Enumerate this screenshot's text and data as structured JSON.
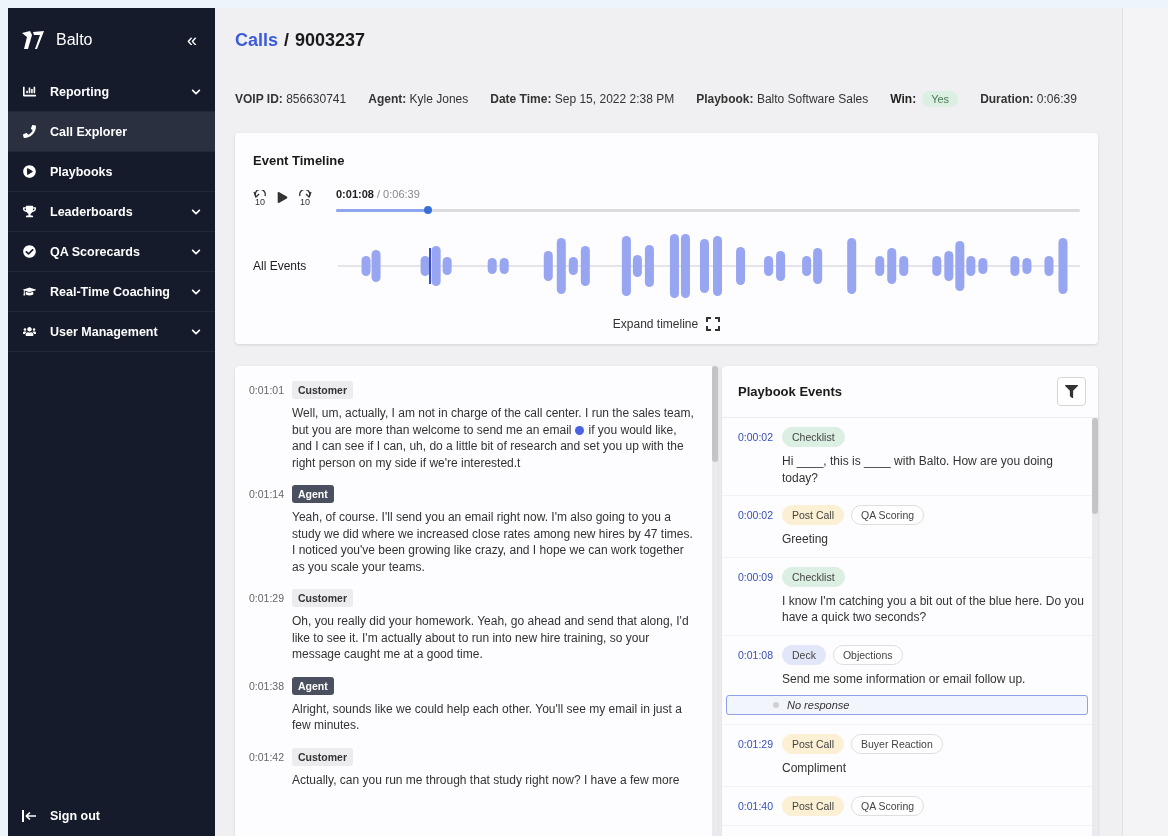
{
  "sidebar": {
    "brand": "Balto",
    "collapse": "«",
    "items": [
      {
        "label": "Reporting",
        "selected": false,
        "expandable": true
      },
      {
        "label": "Call Explorer",
        "selected": true,
        "expandable": false
      },
      {
        "label": "Playbooks",
        "selected": false,
        "expandable": false
      },
      {
        "label": "Leaderboards",
        "selected": false,
        "expandable": true
      },
      {
        "label": "QA Scorecards",
        "selected": false,
        "expandable": true
      },
      {
        "label": "Real-Time Coaching",
        "selected": false,
        "expandable": true
      },
      {
        "label": "User Management",
        "selected": false,
        "expandable": true
      }
    ],
    "sign_out": "Sign out"
  },
  "breadcrumb": {
    "link": "Calls",
    "separator": "/",
    "current": "9003237"
  },
  "meta": [
    {
      "label": "VOIP ID:",
      "value": "856630741"
    },
    {
      "label": "Agent:",
      "value": "Kyle Jones"
    },
    {
      "label": "Date Time:",
      "value": "Sep 15, 2022 2:38 PM"
    },
    {
      "label": "Playbook:",
      "value": "Balto Software Sales"
    },
    {
      "label": "Win:",
      "value": "Yes",
      "kind": "badge"
    },
    {
      "label": "Duration:",
      "value": "0:06:39"
    }
  ],
  "timeline": {
    "title": "Event Timeline",
    "rewind": "10",
    "forward": "10",
    "current": "0:01:08",
    "total": "/ 0:06:39",
    "level": 0.124,
    "row_label": "All Events",
    "expand": "Expand timeline"
  },
  "transcript": [
    {
      "time": "0:01:01",
      "speaker": "Customer",
      "kind": "customer",
      "text": "Well, um, actually, I am not in charge of the call center. I run the sales team, but you are more than welcome to send me an email",
      "text_after": "if you would like, and I can see if I can, uh, do a little bit of research and set you up with the right person on my side if we're interested.t"
    },
    {
      "time": "0:01:14",
      "speaker": "Agent",
      "kind": "agent",
      "text": "Yeah, of course. I'll send you an email right now. I'm also going to you a study we did where we increased close rates among new hires by 47 times. I noticed you've been growing like crazy, and I hope we can work together as you scale your teams."
    },
    {
      "time": "0:01:29",
      "speaker": "Customer",
      "kind": "customer",
      "text": "Oh, you really did your homework. Yeah, go ahead and send that along, I'd like to see it. I'm actually about to run into new hire training, so your message caught me at a good time."
    },
    {
      "time": "0:01:38",
      "speaker": "Agent",
      "kind": "agent",
      "text": "Alright, sounds like we could help each other. You'll see my email in just a few minutes."
    },
    {
      "time": "0:01:42",
      "speaker": "Customer",
      "kind": "customer",
      "text": "Actually, can you run me through that study right now? I have a few more"
    }
  ],
  "events": {
    "title": "Playbook Events",
    "items": [
      {
        "time": "0:00:02",
        "tags": [
          {
            "label": "Checklist",
            "kind": "fill",
            "color": "#dcefe3"
          }
        ],
        "text": "Hi ____, this is ____ with Balto. How are you doing today?"
      },
      {
        "time": "0:00:02",
        "tags": [
          {
            "label": "Post Call",
            "kind": "fill",
            "color": "#fbf0d4"
          },
          {
            "label": "QA Scoring",
            "kind": "outline"
          }
        ],
        "text": "Greeting"
      },
      {
        "time": "0:00:09",
        "tags": [
          {
            "label": "Checklist",
            "kind": "fill",
            "color": "#dcefe3"
          }
        ],
        "text": "I know I'm catching you a bit out of the blue here. Do you have a quick two seconds?"
      },
      {
        "time": "0:01:08",
        "tags": [
          {
            "label": "Deck",
            "kind": "fill",
            "color": "#e1e7f8"
          },
          {
            "label": "Objections",
            "kind": "outline"
          }
        ],
        "text": "Send me some information or email follow up.",
        "response": "No response",
        "highlighted": true
      },
      {
        "time": "0:01:29",
        "tags": [
          {
            "label": "Post Call",
            "kind": "fill",
            "color": "#fbf0d4"
          },
          {
            "label": "Buyer Reaction",
            "kind": "outline"
          }
        ],
        "text": "Compliment"
      },
      {
        "time": "0:01:40",
        "tags": [
          {
            "label": "Post Call",
            "kind": "fill",
            "color": "#fbf0d4"
          },
          {
            "label": "QA Scoring",
            "kind": "outline"
          }
        ]
      }
    ]
  }
}
